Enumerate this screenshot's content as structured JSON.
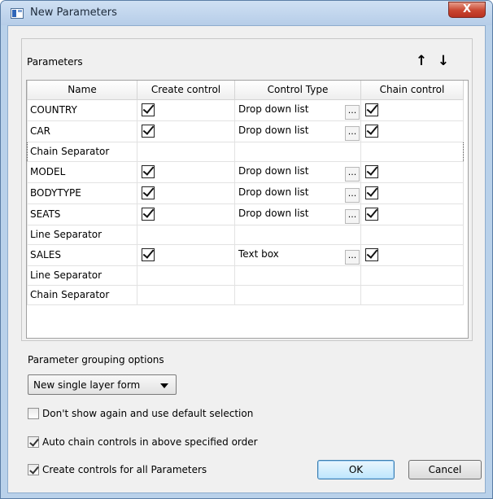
{
  "window": {
    "title": "New Parameters",
    "close_glyph": "X"
  },
  "parameters": {
    "label": "Parameters",
    "move_up_icon": "↑",
    "move_down_icon": "↓",
    "columns": [
      "Name",
      "Create control",
      "Control Type",
      "Chain control"
    ],
    "rows": [
      {
        "name": "COUNTRY",
        "create": true,
        "type": "Drop down list",
        "chain": true
      },
      {
        "name": "CAR",
        "create": true,
        "type": "Drop down list",
        "chain": true
      },
      {
        "name": "Chain Separator",
        "separator": true,
        "selected": true
      },
      {
        "name": "MODEL",
        "create": true,
        "type": "Drop down list",
        "chain": true
      },
      {
        "name": "BODYTYPE",
        "create": true,
        "type": "Drop down list",
        "chain": true
      },
      {
        "name": "SEATS",
        "create": true,
        "type": "Drop down list",
        "chain": true
      },
      {
        "name": "Line Separator",
        "separator": true
      },
      {
        "name": "SALES",
        "create": true,
        "type": "Text box",
        "chain": true
      },
      {
        "name": "Line Separator",
        "separator": true
      },
      {
        "name": "Chain Separator",
        "separator": true
      }
    ],
    "ellipsis": "..."
  },
  "grouping": {
    "label": "Parameter grouping options",
    "selected": "New single layer form"
  },
  "options": [
    {
      "label": "Don't show again and use default selection",
      "checked": false
    },
    {
      "label": "Auto chain controls in above specified order",
      "checked": true
    },
    {
      "label": "Create controls for all Parameters",
      "checked": true
    }
  ],
  "buttons": {
    "ok": "OK",
    "cancel": "Cancel"
  }
}
